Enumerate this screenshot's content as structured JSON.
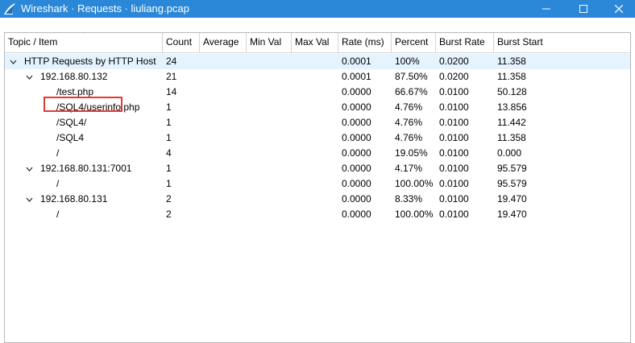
{
  "window": {
    "title": "Wireshark · Requests · liuliang.pcap"
  },
  "columns": [
    "Topic / Item",
    "Count",
    "Average",
    "Min Val",
    "Max Val",
    "Rate (ms)",
    "Percent",
    "Burst Rate",
    "Burst Start"
  ],
  "rows": [
    {
      "item": "HTTP Requests by HTTP Host",
      "count": "24",
      "rate": "0.0001",
      "percent": "100%",
      "burst_rate": "0.0200",
      "burst_start": "11.358",
      "level": 0,
      "expandable": true,
      "selected": true
    },
    {
      "item": "192.168.80.132",
      "count": "21",
      "rate": "0.0001",
      "percent": "87.50%",
      "burst_rate": "0.0200",
      "burst_start": "11.358",
      "level": 1,
      "expandable": true
    },
    {
      "item": "/test.php",
      "count": "14",
      "rate": "0.0000",
      "percent": "66.67%",
      "burst_rate": "0.0100",
      "burst_start": "50.128",
      "level": 2
    },
    {
      "item": "/SQL4/userinfo.php",
      "count": "1",
      "rate": "0.0000",
      "percent": "4.76%",
      "burst_rate": "0.0100",
      "burst_start": "13.856",
      "level": 2
    },
    {
      "item": "/SQL4/",
      "count": "1",
      "rate": "0.0000",
      "percent": "4.76%",
      "burst_rate": "0.0100",
      "burst_start": "11.442",
      "level": 2
    },
    {
      "item": "/SQL4",
      "count": "1",
      "rate": "0.0000",
      "percent": "4.76%",
      "burst_rate": "0.0100",
      "burst_start": "11.358",
      "level": 2
    },
    {
      "item": "/",
      "count": "4",
      "rate": "0.0000",
      "percent": "19.05%",
      "burst_rate": "0.0100",
      "burst_start": "0.000",
      "level": 2
    },
    {
      "item": "192.168.80.131:7001",
      "count": "1",
      "rate": "0.0000",
      "percent": "4.17%",
      "burst_rate": "0.0100",
      "burst_start": "95.579",
      "level": 1,
      "expandable": true
    },
    {
      "item": "/",
      "count": "1",
      "rate": "0.0000",
      "percent": "100.00%",
      "burst_rate": "0.0100",
      "burst_start": "95.579",
      "level": 2
    },
    {
      "item": "192.168.80.131",
      "count": "2",
      "rate": "0.0000",
      "percent": "8.33%",
      "burst_rate": "0.0100",
      "burst_start": "19.470",
      "level": 1,
      "expandable": true
    },
    {
      "item": "/",
      "count": "2",
      "rate": "0.0000",
      "percent": "100.00%",
      "burst_rate": "0.0100",
      "burst_start": "19.470",
      "level": 2
    }
  ]
}
